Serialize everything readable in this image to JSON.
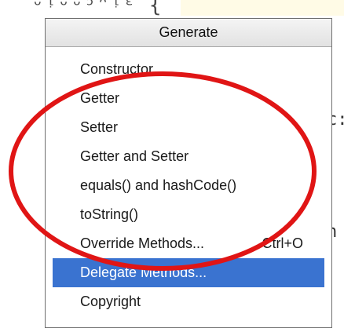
{
  "popup": {
    "title": "Generate",
    "items": [
      {
        "label": "Constructor"
      },
      {
        "label": "Getter"
      },
      {
        "label": "Setter"
      },
      {
        "label": "Getter and Setter"
      },
      {
        "label": "equals() and hashCode()"
      },
      {
        "label": "toString()"
      },
      {
        "label": "Override Methods...",
        "shortcut": "Ctrl+O"
      },
      {
        "label": "Delegate Methods...",
        "selected": true
      },
      {
        "label": "Copyright"
      }
    ]
  },
  "colors": {
    "selection": "#3a73d0",
    "annotation": "#e01515",
    "header_bg": "#e8e8e8"
  },
  "icons": {
    "annotation": "red-ellipse-annotation"
  }
}
